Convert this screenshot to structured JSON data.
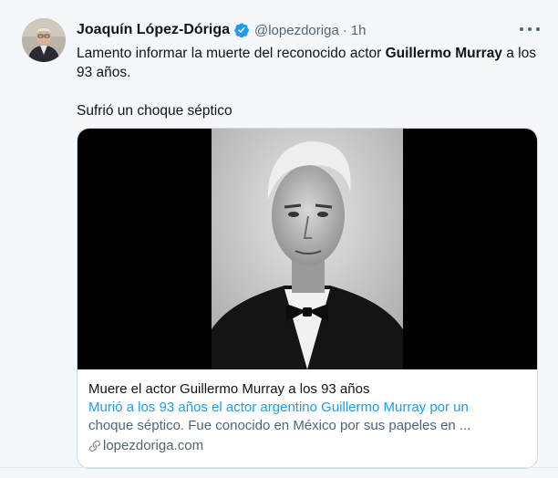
{
  "tweet": {
    "author_name": "Joaquín López-Dóriga",
    "handle": "@lopezdoriga",
    "separator": "·",
    "time": "1h",
    "text_part1": "Lamento informar la muerte del reconocido actor ",
    "text_bold": "Guillermo Murray",
    "text_part2": " a los 93 años.",
    "text_para2": "Sufrió un choque séptico"
  },
  "card": {
    "title": "Muere el actor Guillermo Murray a los 93 años",
    "description_line1": "Murió a los 93 años el actor argentino Guillermo Murray por un",
    "description_line2": "choque séptico. Fue conocido en México por sus papeles en ...",
    "domain": "lopezdoriga.com"
  },
  "colors": {
    "verified_badge": "#1d9bf0",
    "secondary_text": "#536471",
    "card_border": "#cfd9de"
  },
  "icons": {
    "verified": "verified-badge-icon",
    "more": "more-options-icon",
    "link": "link-icon"
  }
}
